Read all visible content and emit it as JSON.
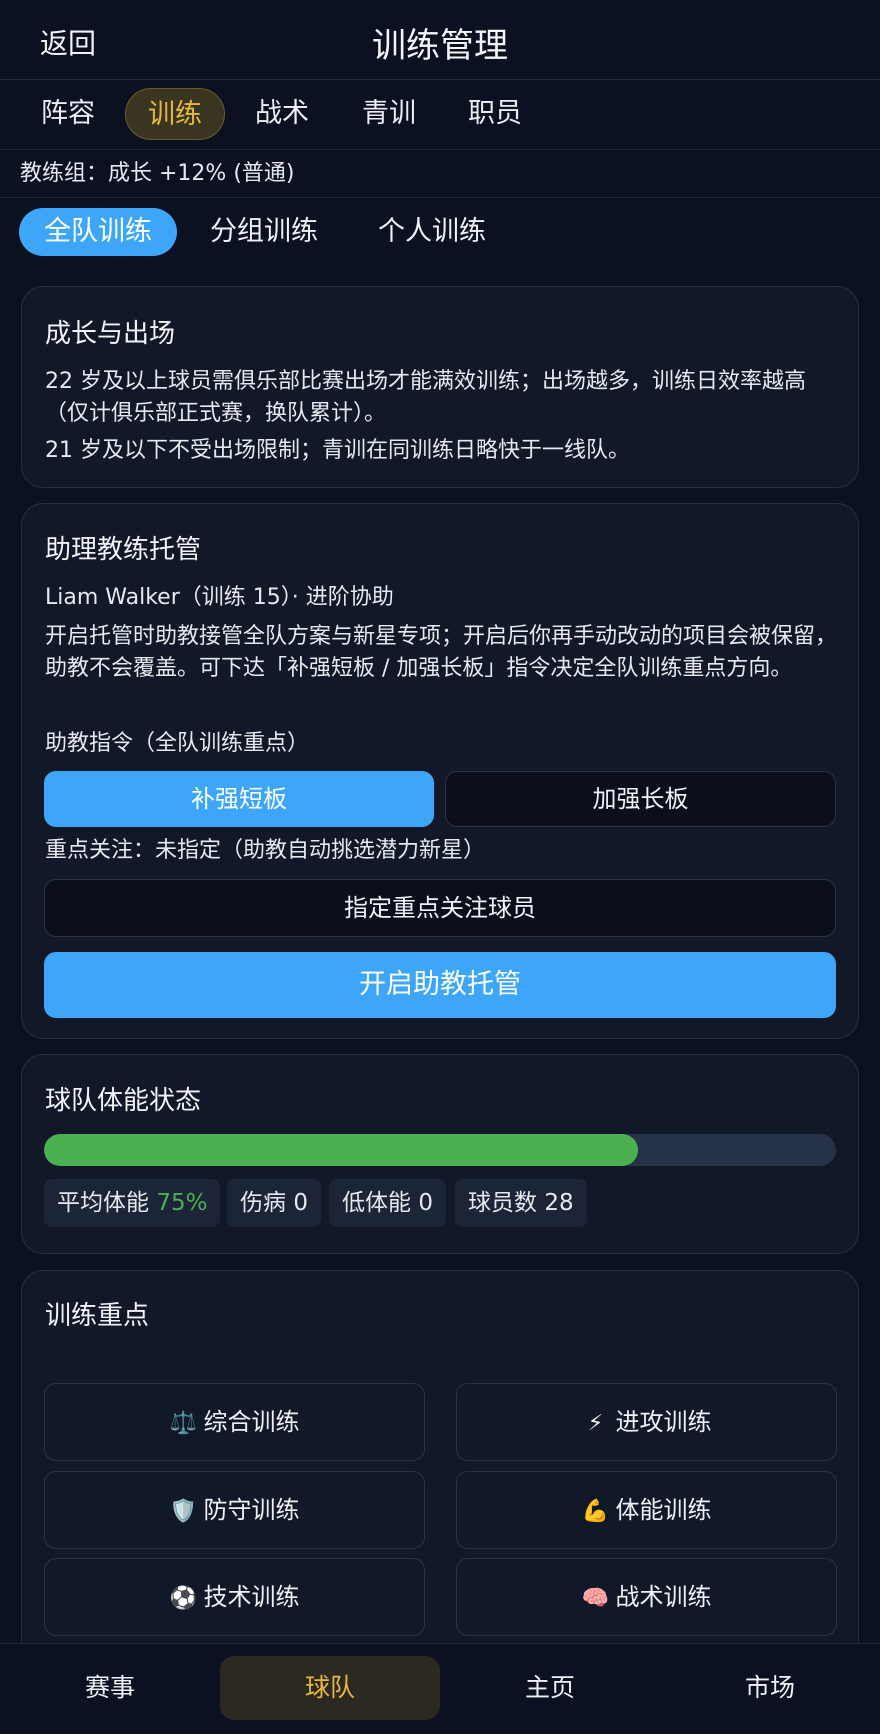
{
  "header": {
    "back_label": "返回",
    "title": "训练管理"
  },
  "main_tabs": [
    {
      "label": "阵容"
    },
    {
      "label": "训练"
    },
    {
      "label": "战术"
    },
    {
      "label": "青训"
    },
    {
      "label": "职员"
    }
  ],
  "coach_line": "教练组：成长 +12% (普通)",
  "sub_tabs": [
    {
      "label": "全队训练"
    },
    {
      "label": "分组训练"
    },
    {
      "label": "个人训练"
    }
  ],
  "growth_card": {
    "title": "成长与出场",
    "para1": "22 岁及以上球员需俱乐部比赛出场才能满效训练；出场越多，训练日效率越高（仅计俱乐部正式赛，换队累计）。",
    "para2": "21 岁及以下不受出场限制；青训在同训练日略快于一线队。"
  },
  "assistant_card": {
    "title": "助理教练托管",
    "coach_info": "Liam Walker（训练 15）· 进阶协助",
    "description": "开启托管时助教接管全队方案与新星专项；开启后你再手动改动的项目会被保留，助教不会覆盖。可下达「补强短板 / 加强长板」指令决定全队训练重点方向。",
    "directive_label": "助教指令（全队训练重点）",
    "directive_options": [
      "补强短板",
      "加强长板"
    ],
    "focus_status": "重点关注：未指定（助教自动挑选潜力新星）",
    "assign_focus_label": "指定重点关注球员",
    "enable_label": "开启助教托管"
  },
  "fitness_card": {
    "title": "球队体能状态",
    "avg_fitness": 75,
    "avg_label": "平均体能",
    "avg_value": "75%",
    "injury_label": "伤病",
    "injury_value": "0",
    "low_label": "低体能",
    "low_value": "0",
    "players_label": "球员数",
    "players_value": "28",
    "colors": {
      "fill": "#4cb050",
      "track": "#263248"
    }
  },
  "focus_card": {
    "title": "训练重点",
    "items": [
      {
        "icon": "balance-scale-icon",
        "glyph": "⚖️",
        "label": "综合训练"
      },
      {
        "icon": "lightning-icon",
        "glyph": "⚡",
        "label": "进攻训练"
      },
      {
        "icon": "shield-icon",
        "glyph": "🛡️",
        "label": "防守训练"
      },
      {
        "icon": "flexed-bicep-icon",
        "glyph": "💪",
        "label": "体能训练"
      },
      {
        "icon": "soccer-ball-icon",
        "glyph": "⚽",
        "label": "技术训练"
      },
      {
        "icon": "brain-icon",
        "glyph": "🧠",
        "label": "战术训练"
      }
    ]
  },
  "bottom_nav": [
    {
      "label": "赛事"
    },
    {
      "label": "球队"
    },
    {
      "label": "主页"
    },
    {
      "label": "市场"
    }
  ],
  "colors": {
    "accent_blue": "#3ea6f8",
    "accent_gold": "#e7b743",
    "background": "#0b1120"
  }
}
